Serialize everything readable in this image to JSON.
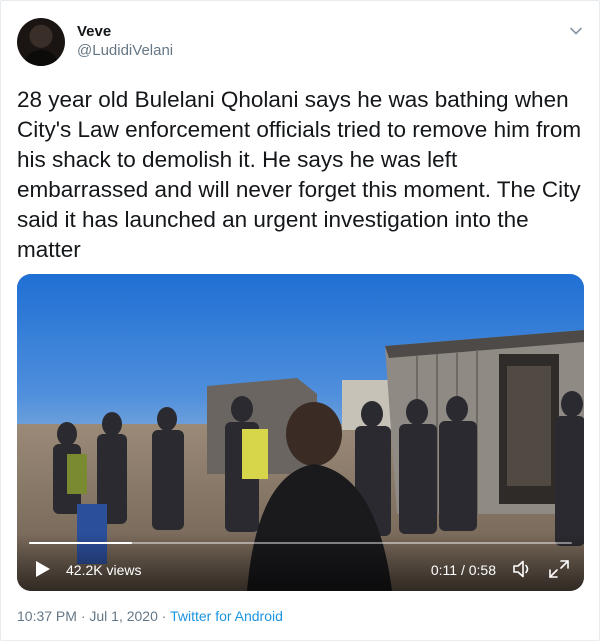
{
  "author": {
    "display_name": "Veve",
    "handle": "@LudidiVelani",
    "avatar_icon": "profile-avatar"
  },
  "tweet": {
    "text": "28 year old Bulelani Qholani says he was bathing when City's Law enforcement officials tried to remove him from his shack to demolish it. He says he was left embarrassed and will never forget this moment. The City said it has launched an urgent investigation into the matter"
  },
  "video": {
    "views": "42.2K views",
    "time": "0:11 / 0:58",
    "progress_fraction": 0.19,
    "play_icon": "play-icon",
    "volume_icon": "volume-icon",
    "fullscreen_icon": "fullscreen-icon"
  },
  "meta": {
    "timestamp": "10:37 PM · Jul 1, 2020",
    "separator": " · ",
    "source": "Twitter for Android"
  },
  "colors": {
    "link": "#1b95e0",
    "secondary_text": "#657786",
    "primary_text": "#14171a"
  },
  "icons": {
    "caret": "chevron-down-icon"
  }
}
